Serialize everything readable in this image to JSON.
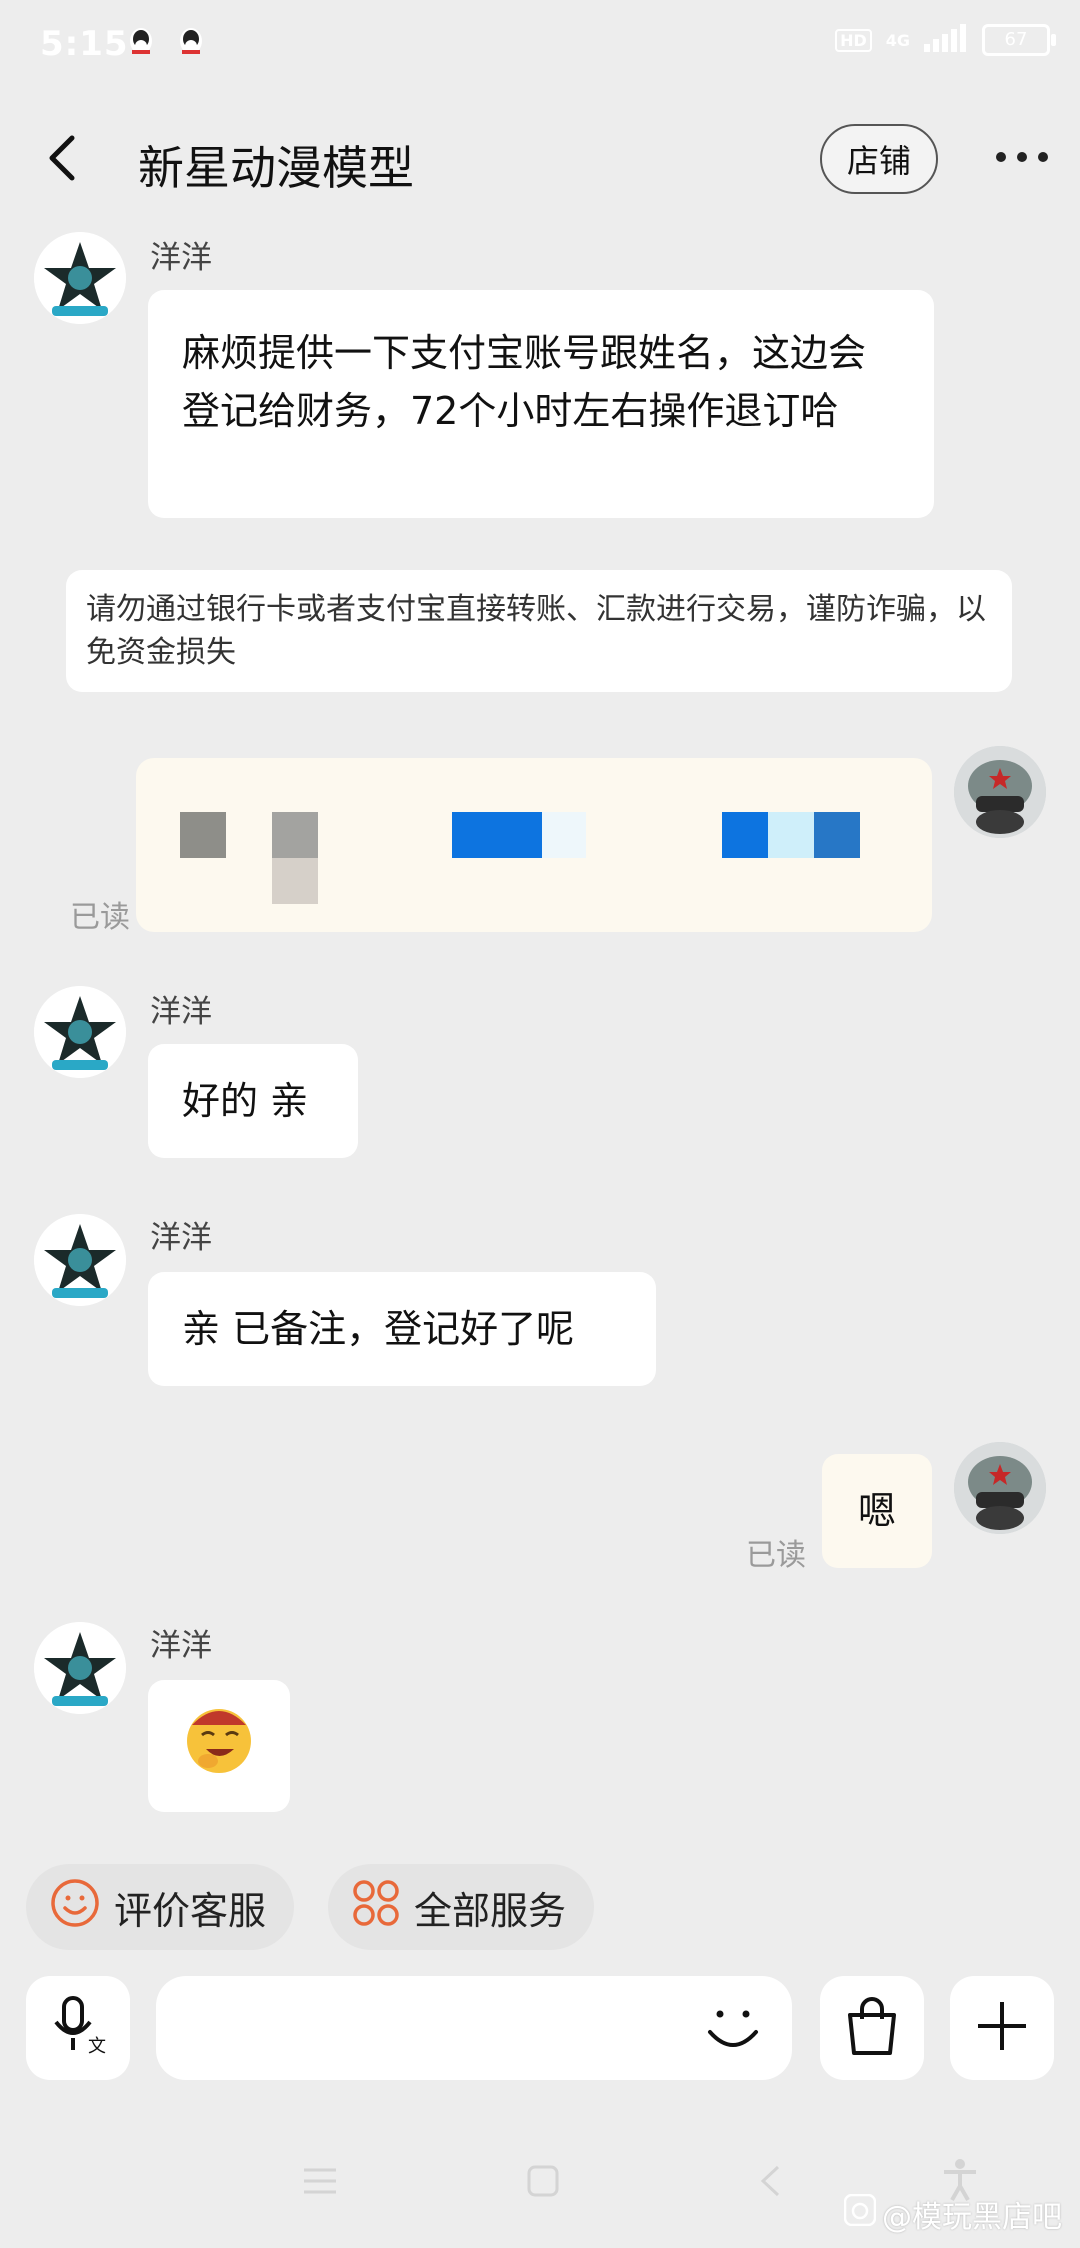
{
  "status_bar": {
    "time": "5:15",
    "hd": "HD",
    "network": "4G",
    "battery": "67"
  },
  "header": {
    "title": "新星动漫模型",
    "shop_label": "店铺"
  },
  "messages": [
    {
      "sender": "洋洋",
      "text": "麻烦提供一下支付宝账号跟姓名，这边会登记给财务，72个小时左右操作退订哈"
    },
    {
      "notice": "请勿通过银行卡或者支付宝直接转账、汇款进行交易，谨防诈骗，以免资金损失"
    },
    {
      "read": "已读"
    },
    {
      "sender": "洋洋",
      "text": "好的 亲"
    },
    {
      "sender": "洋洋",
      "text": "亲 已备注，登记好了呢"
    },
    {
      "text": "嗯",
      "read": "已读"
    },
    {
      "sender": "洋洋",
      "emoji": "🤭"
    }
  ],
  "quick_actions": [
    {
      "label": "评价客服",
      "icon": "smile-icon"
    },
    {
      "label": "全部服务",
      "icon": "grid-icon"
    }
  ],
  "watermark": "@模玩黑店吧",
  "colors": {
    "accent": "#e8693a",
    "background": "#ededed"
  }
}
